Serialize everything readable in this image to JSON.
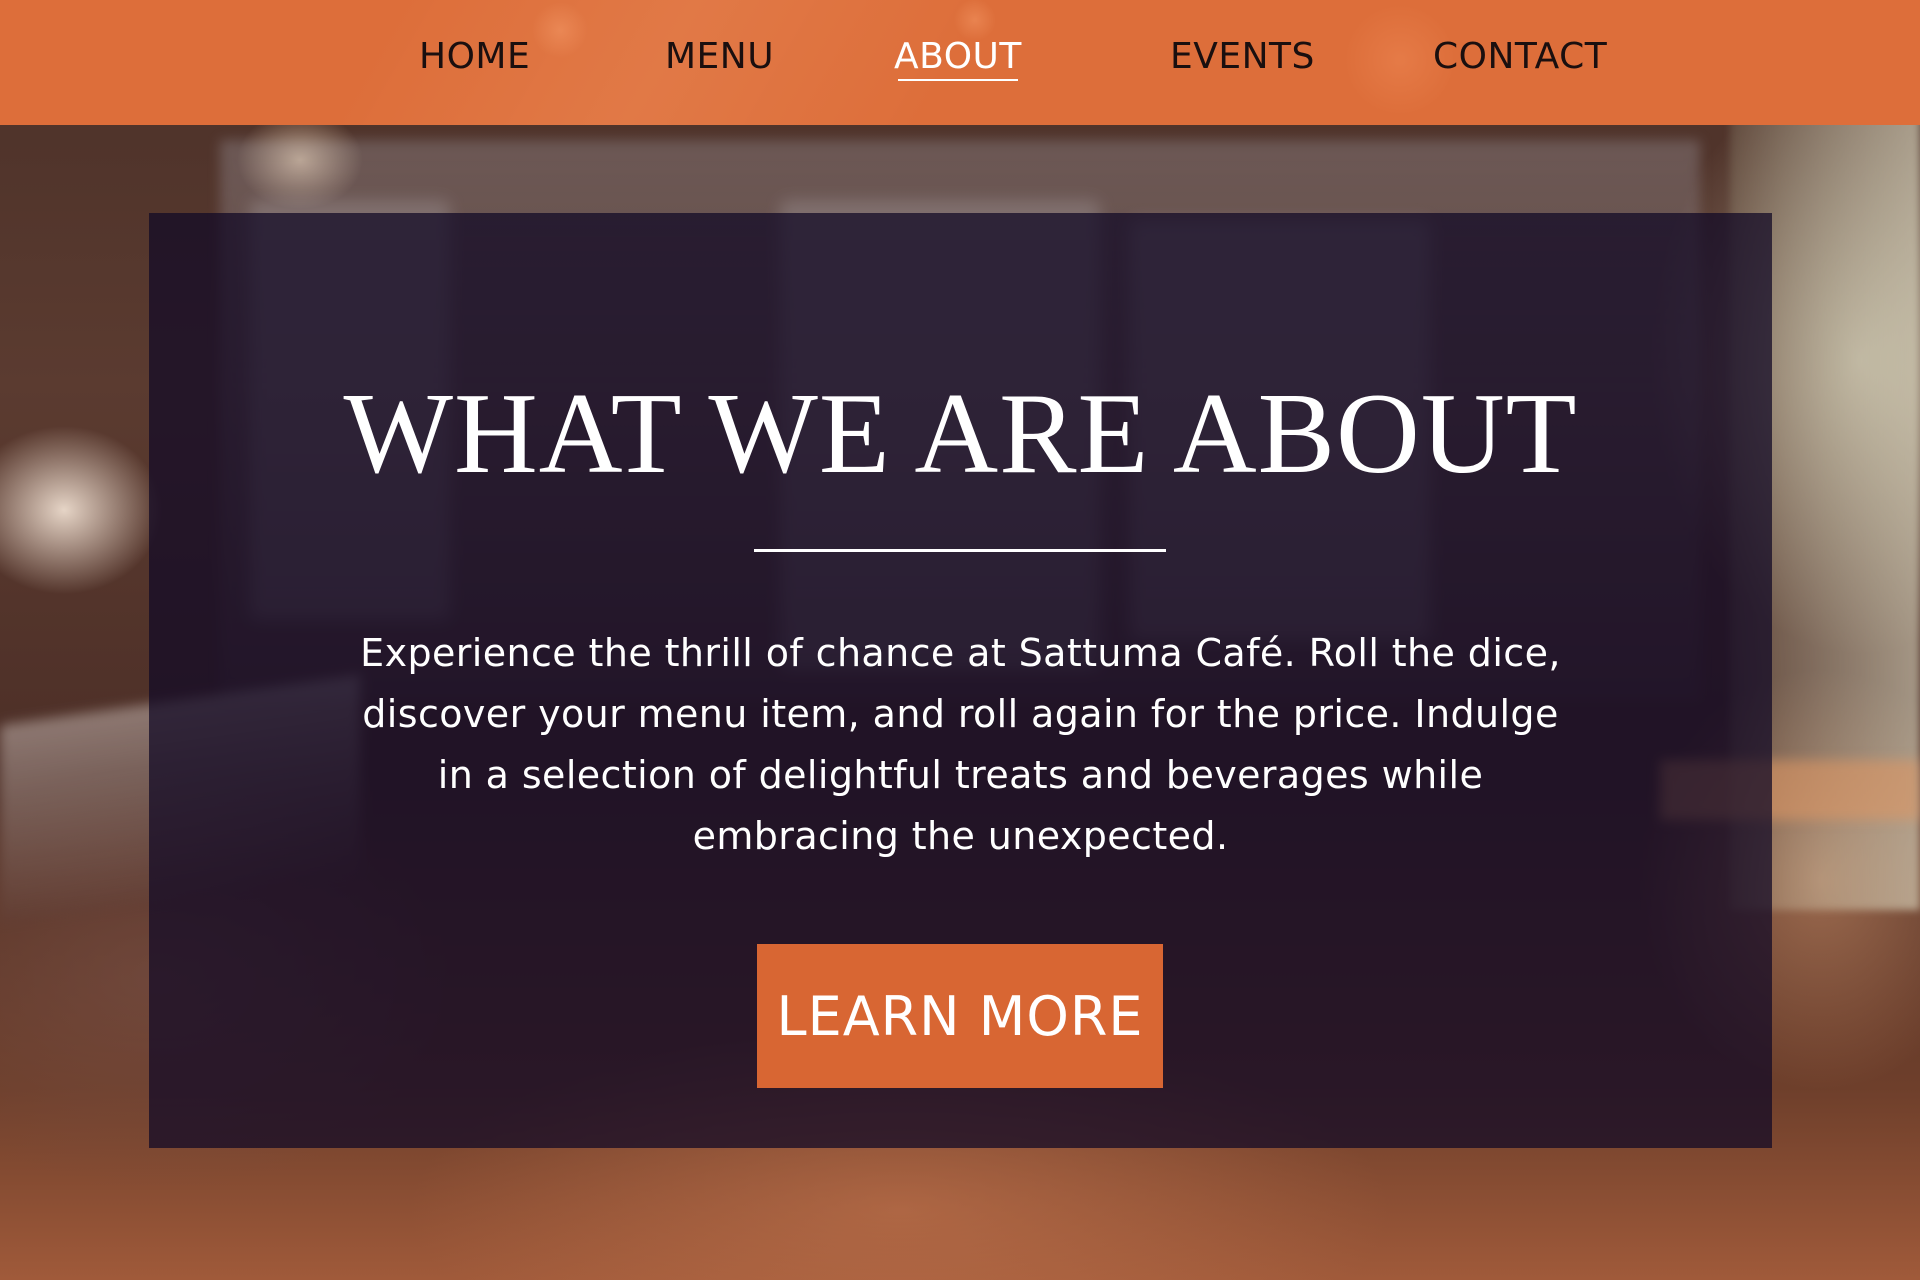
{
  "nav": {
    "items": [
      {
        "label": "HOME",
        "active": false
      },
      {
        "label": "MENU",
        "active": false
      },
      {
        "label": "ABOUT",
        "active": true
      },
      {
        "label": "EVENTS",
        "active": false
      },
      {
        "label": "CONTACT",
        "active": false
      }
    ]
  },
  "hero": {
    "title": "WHAT WE ARE ABOUT",
    "description": "Experience the thrill of chance at Sattuma Café. Roll the dice, discover your menu item, and roll again for the price. Indulge in a selection of delightful treats and beverages while embracing the unexpected.",
    "button_label": "LEARN MORE"
  },
  "colors": {
    "accent": "#dd6e3a",
    "button": "#d86633",
    "panel": "#120a26",
    "text_light": "#ffffff",
    "text_dark": "#1a0f0f"
  }
}
